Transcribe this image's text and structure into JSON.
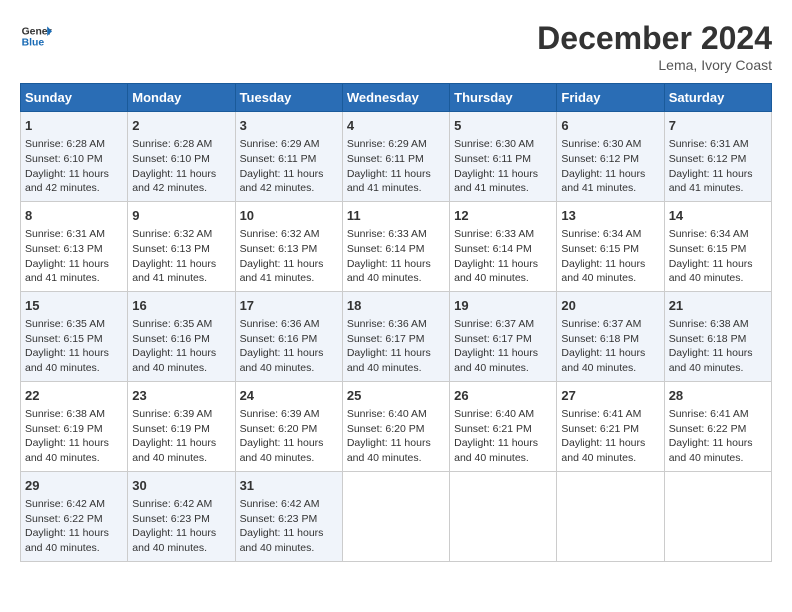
{
  "header": {
    "logo_line1": "General",
    "logo_line2": "Blue",
    "month_title": "December 2024",
    "location": "Lema, Ivory Coast"
  },
  "calendar": {
    "days_of_week": [
      "Sunday",
      "Monday",
      "Tuesday",
      "Wednesday",
      "Thursday",
      "Friday",
      "Saturday"
    ],
    "weeks": [
      [
        {
          "day": "",
          "empty": true
        },
        {
          "day": "",
          "empty": true
        },
        {
          "day": "",
          "empty": true
        },
        {
          "day": "",
          "empty": true
        },
        {
          "day": "",
          "empty": true
        },
        {
          "day": "",
          "empty": true
        },
        {
          "day": "",
          "empty": true
        }
      ],
      [
        {
          "day": "1",
          "sunrise": "6:28 AM",
          "sunset": "6:10 PM",
          "daylight": "11 hours and 42 minutes."
        },
        {
          "day": "2",
          "sunrise": "6:28 AM",
          "sunset": "6:10 PM",
          "daylight": "11 hours and 42 minutes."
        },
        {
          "day": "3",
          "sunrise": "6:29 AM",
          "sunset": "6:11 PM",
          "daylight": "11 hours and 42 minutes."
        },
        {
          "day": "4",
          "sunrise": "6:29 AM",
          "sunset": "6:11 PM",
          "daylight": "11 hours and 41 minutes."
        },
        {
          "day": "5",
          "sunrise": "6:30 AM",
          "sunset": "6:11 PM",
          "daylight": "11 hours and 41 minutes."
        },
        {
          "day": "6",
          "sunrise": "6:30 AM",
          "sunset": "6:12 PM",
          "daylight": "11 hours and 41 minutes."
        },
        {
          "day": "7",
          "sunrise": "6:31 AM",
          "sunset": "6:12 PM",
          "daylight": "11 hours and 41 minutes."
        }
      ],
      [
        {
          "day": "8",
          "sunrise": "6:31 AM",
          "sunset": "6:13 PM",
          "daylight": "11 hours and 41 minutes."
        },
        {
          "day": "9",
          "sunrise": "6:32 AM",
          "sunset": "6:13 PM",
          "daylight": "11 hours and 41 minutes."
        },
        {
          "day": "10",
          "sunrise": "6:32 AM",
          "sunset": "6:13 PM",
          "daylight": "11 hours and 41 minutes."
        },
        {
          "day": "11",
          "sunrise": "6:33 AM",
          "sunset": "6:14 PM",
          "daylight": "11 hours and 40 minutes."
        },
        {
          "day": "12",
          "sunrise": "6:33 AM",
          "sunset": "6:14 PM",
          "daylight": "11 hours and 40 minutes."
        },
        {
          "day": "13",
          "sunrise": "6:34 AM",
          "sunset": "6:15 PM",
          "daylight": "11 hours and 40 minutes."
        },
        {
          "day": "14",
          "sunrise": "6:34 AM",
          "sunset": "6:15 PM",
          "daylight": "11 hours and 40 minutes."
        }
      ],
      [
        {
          "day": "15",
          "sunrise": "6:35 AM",
          "sunset": "6:15 PM",
          "daylight": "11 hours and 40 minutes."
        },
        {
          "day": "16",
          "sunrise": "6:35 AM",
          "sunset": "6:16 PM",
          "daylight": "11 hours and 40 minutes."
        },
        {
          "day": "17",
          "sunrise": "6:36 AM",
          "sunset": "6:16 PM",
          "daylight": "11 hours and 40 minutes."
        },
        {
          "day": "18",
          "sunrise": "6:36 AM",
          "sunset": "6:17 PM",
          "daylight": "11 hours and 40 minutes."
        },
        {
          "day": "19",
          "sunrise": "6:37 AM",
          "sunset": "6:17 PM",
          "daylight": "11 hours and 40 minutes."
        },
        {
          "day": "20",
          "sunrise": "6:37 AM",
          "sunset": "6:18 PM",
          "daylight": "11 hours and 40 minutes."
        },
        {
          "day": "21",
          "sunrise": "6:38 AM",
          "sunset": "6:18 PM",
          "daylight": "11 hours and 40 minutes."
        }
      ],
      [
        {
          "day": "22",
          "sunrise": "6:38 AM",
          "sunset": "6:19 PM",
          "daylight": "11 hours and 40 minutes."
        },
        {
          "day": "23",
          "sunrise": "6:39 AM",
          "sunset": "6:19 PM",
          "daylight": "11 hours and 40 minutes."
        },
        {
          "day": "24",
          "sunrise": "6:39 AM",
          "sunset": "6:20 PM",
          "daylight": "11 hours and 40 minutes."
        },
        {
          "day": "25",
          "sunrise": "6:40 AM",
          "sunset": "6:20 PM",
          "daylight": "11 hours and 40 minutes."
        },
        {
          "day": "26",
          "sunrise": "6:40 AM",
          "sunset": "6:21 PM",
          "daylight": "11 hours and 40 minutes."
        },
        {
          "day": "27",
          "sunrise": "6:41 AM",
          "sunset": "6:21 PM",
          "daylight": "11 hours and 40 minutes."
        },
        {
          "day": "28",
          "sunrise": "6:41 AM",
          "sunset": "6:22 PM",
          "daylight": "11 hours and 40 minutes."
        }
      ],
      [
        {
          "day": "29",
          "sunrise": "6:42 AM",
          "sunset": "6:22 PM",
          "daylight": "11 hours and 40 minutes."
        },
        {
          "day": "30",
          "sunrise": "6:42 AM",
          "sunset": "6:23 PM",
          "daylight": "11 hours and 40 minutes."
        },
        {
          "day": "31",
          "sunrise": "6:42 AM",
          "sunset": "6:23 PM",
          "daylight": "11 hours and 40 minutes."
        },
        {
          "day": "",
          "empty": true
        },
        {
          "day": "",
          "empty": true
        },
        {
          "day": "",
          "empty": true
        },
        {
          "day": "",
          "empty": true
        }
      ]
    ]
  }
}
